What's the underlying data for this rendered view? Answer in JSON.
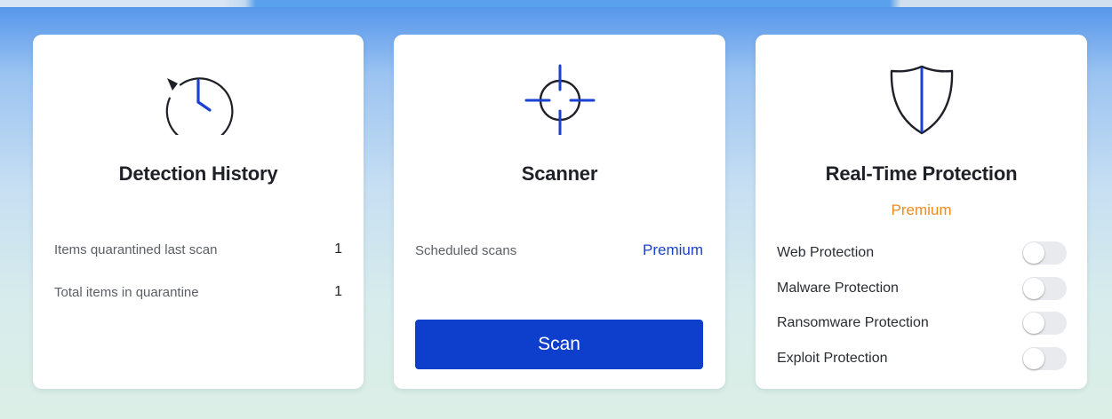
{
  "colors": {
    "accent": "#0d3fcc",
    "premium_link": "#1a41d2",
    "premium_badge": "#f08a1d",
    "card_bg": "#ffffff"
  },
  "cards": {
    "detection_history": {
      "icon": "clock-history-icon",
      "title": "Detection History",
      "stats": [
        {
          "label": "Items quarantined last scan",
          "value": "1"
        },
        {
          "label": "Total items in quarantine",
          "value": "1"
        }
      ]
    },
    "scanner": {
      "icon": "crosshair-icon",
      "title": "Scanner",
      "scheduled_label": "Scheduled scans",
      "scheduled_value": "Premium",
      "scan_button": "Scan"
    },
    "real_time_protection": {
      "icon": "shield-icon",
      "title": "Real-Time Protection",
      "badge": "Premium",
      "toggles": [
        {
          "label": "Web Protection",
          "on": false
        },
        {
          "label": "Malware Protection",
          "on": false
        },
        {
          "label": "Ransomware Protection",
          "on": false
        },
        {
          "label": "Exploit Protection",
          "on": false
        }
      ]
    }
  }
}
